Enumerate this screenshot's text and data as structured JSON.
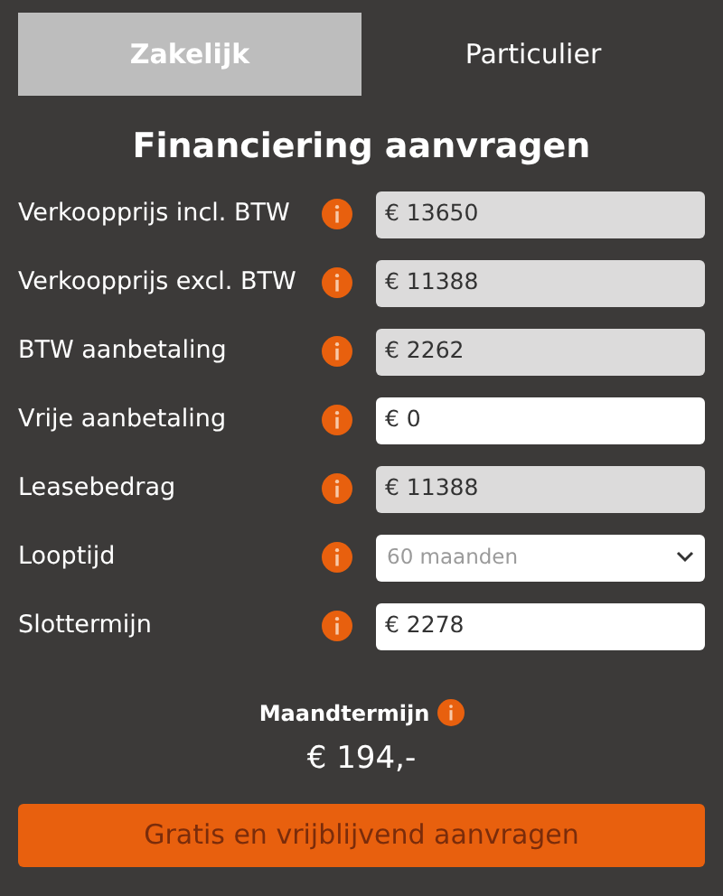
{
  "tabs": [
    {
      "label": "Zakelijk",
      "selected": true
    },
    {
      "label": "Particulier",
      "selected": false
    }
  ],
  "title": "Financiering aanvragen",
  "fields": [
    {
      "label": "Verkoopprijs incl. BTW",
      "kind": "readonly",
      "value": "€ 13650"
    },
    {
      "label": "Verkoopprijs excl. BTW",
      "kind": "readonly",
      "value": "€ 11388"
    },
    {
      "label": "BTW aanbetaling",
      "kind": "readonly",
      "value": "€ 2262"
    },
    {
      "label": "Vrije aanbetaling",
      "kind": "input",
      "value": "€ 0"
    },
    {
      "label": "Leasebedrag",
      "kind": "readonly",
      "value": "€ 11388"
    },
    {
      "label": "Looptijd",
      "kind": "select",
      "value": "60 maanden"
    },
    {
      "label": "Slottermijn",
      "kind": "input",
      "value": "€ 2278"
    }
  ],
  "monthly": {
    "label": "Maandtermijn",
    "value": "€ 194,-"
  },
  "submit": "Gratis en vrijblijvend aanvragen"
}
